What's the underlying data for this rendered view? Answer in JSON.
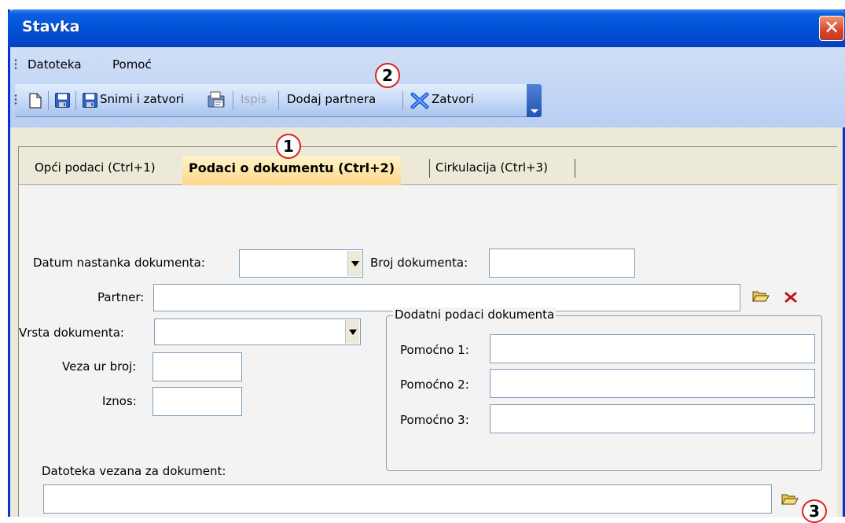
{
  "window": {
    "title": "Stavka",
    "close_glyph": "✕"
  },
  "menu": {
    "items": [
      "Datoteka",
      "Pomoć"
    ]
  },
  "toolbar": {
    "save_close_label": "Snimi i zatvori",
    "print_label": "Ispis",
    "add_partner_label": "Dodaj partnera",
    "close_label": "Zatvori"
  },
  "callouts": [
    "1",
    "2",
    "3"
  ],
  "tabs": [
    {
      "label": "Opći podaci (Ctrl+1)",
      "active": false
    },
    {
      "label": "Podaci o dokumentu (Ctrl+2)",
      "active": true
    },
    {
      "label": "Cirkulacija (Ctrl+3)",
      "active": false
    }
  ],
  "form": {
    "date_label": "Datum nastanka dokumenta:",
    "date_value": "",
    "doc_number_label": "Broj dokumenta:",
    "doc_number_value": "",
    "partner_label": "Partner:",
    "partner_value": "",
    "doc_type_label": "Vrsta dokumenta:",
    "doc_type_value": "",
    "ref_label": "Veza ur broj:",
    "ref_value": "",
    "amount_label": "Iznos:",
    "amount_value": "",
    "extra_group_title": "Dodatni podaci dokumenta",
    "aux1_label": "Pomoćno 1:",
    "aux2_label": "Pomoćno 2:",
    "aux3_label": "Pomoćno 3:",
    "file_label": "Datoteka vezana za dokument:",
    "file_value": ""
  },
  "icons": [
    "new-document-icon",
    "save-icon",
    "save-close-icon",
    "print-preview-icon",
    "close-x-icon",
    "open-folder-icon",
    "clear-icon"
  ],
  "colors": {
    "title_bar": "#0254d9",
    "active_tab": "#fcd88a",
    "callout": "#e02020",
    "close_x": "#c0141a"
  }
}
